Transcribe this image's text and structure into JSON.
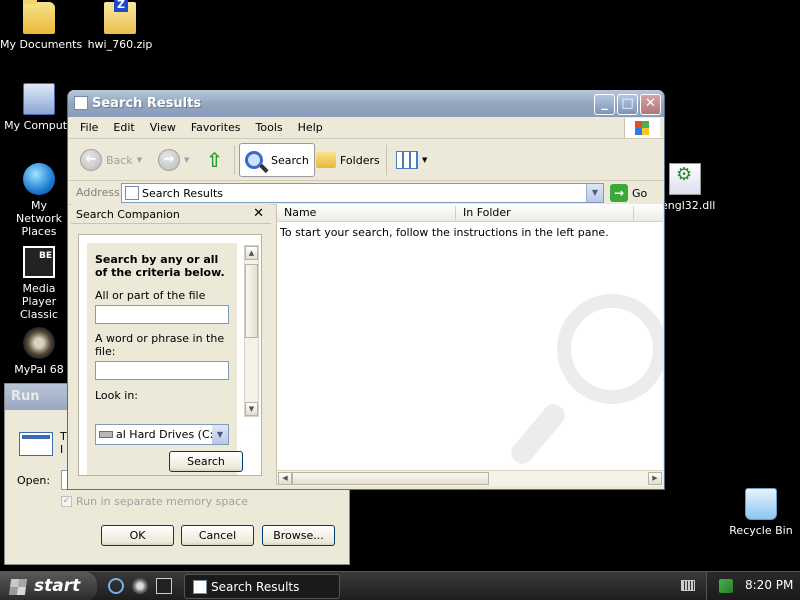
{
  "desktop": {
    "icons": [
      {
        "label": "My Documents"
      },
      {
        "label": "hwi_760.zip"
      },
      {
        "label": "My Compute"
      },
      {
        "label": "My Network Places"
      },
      {
        "label": "Media Player Classic"
      },
      {
        "label": "MyPal 68"
      },
      {
        "label": "engl32.dll"
      },
      {
        "label": "Recycle Bin"
      }
    ]
  },
  "run_dialog": {
    "title": "Run",
    "desc": "T\nI",
    "open_label": "Open:",
    "open_value": "",
    "checkbox_label": "Run in separate memory space",
    "ok": "OK",
    "cancel": "Cancel",
    "browse": "Browse..."
  },
  "window": {
    "title": "Search Results",
    "menu": [
      "File",
      "Edit",
      "View",
      "Favorites",
      "Tools",
      "Help"
    ],
    "toolbar": {
      "back": "Back",
      "search": "Search",
      "folders": "Folders"
    },
    "address": {
      "label": "Address",
      "value": "Search Results",
      "go": "Go"
    },
    "companion": {
      "title": "Search Companion",
      "heading": "Search by any or all of the criteria below.",
      "file_name_label": "All or part of the file name:",
      "file_name_value": "",
      "phrase_label": "A word or phrase in the file:",
      "phrase_value": "",
      "look_in_label": "Look in:",
      "look_in_value": "al Hard Drives (C:)",
      "search_button": "Search"
    },
    "results": {
      "columns": [
        "Name",
        "In Folder"
      ],
      "message": "To start your search, follow the instructions in the left pane."
    }
  },
  "taskbar": {
    "start": "start",
    "task": "Search Results",
    "clock": "8:20 PM"
  }
}
